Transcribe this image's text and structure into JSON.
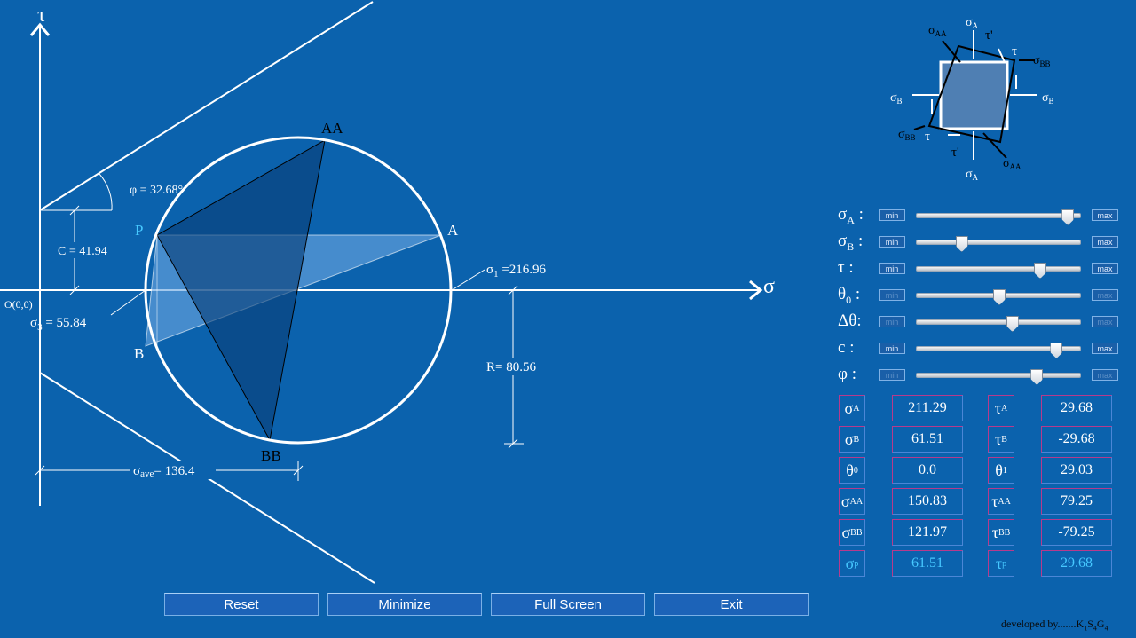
{
  "diagram": {
    "axis_tau_label": "τ",
    "axis_sigma_label": "σ",
    "origin_label": "O(0,0)",
    "point_labels": {
      "AA": "AA",
      "A": "A",
      "P": "P",
      "B": "B",
      "BB": "BB"
    },
    "phi_label": "φ = 32.68°",
    "c_label": "C = 41.94",
    "sigma1": {
      "main": "σ",
      "sub": "1",
      "rest": " =216.96"
    },
    "sigma3": {
      "main": "σ",
      "sub": "3",
      "rest": " = 55.84"
    },
    "radius_label": "R= 80.56",
    "sigma_ave": {
      "main": "σ",
      "sub": "ave",
      "rest": "= 136.4"
    }
  },
  "element": {
    "sigmaA": "σ",
    "sigmaA_sub": "A",
    "sigmaB": "σ",
    "sigmaB_sub": "B",
    "sigmaAA": "σ",
    "sigmaAA_sub": "AA",
    "sigmaBB": "σ",
    "sigmaBB_sub": "BB",
    "tau": "τ",
    "tau_prime": "τ'"
  },
  "sliders": [
    {
      "main": "σ",
      "sub": "A",
      "suffix": " :",
      "min_label": "min",
      "max_label": "max",
      "value": 0.92,
      "enabled": true
    },
    {
      "main": "σ",
      "sub": "B",
      "suffix": " :",
      "min_label": "min",
      "max_label": "max",
      "value": 0.27,
      "enabled": true
    },
    {
      "main": "τ",
      "sub": "",
      "suffix": " :",
      "min_label": "min",
      "max_label": "max",
      "value": 0.75,
      "enabled": true
    },
    {
      "main": "θ",
      "sub": "0",
      "suffix": " :",
      "min_label": "min",
      "max_label": "max",
      "value": 0.5,
      "enabled": false
    },
    {
      "main": "Δθ",
      "sub": "",
      "suffix": ":",
      "min_label": "min",
      "max_label": "max",
      "value": 0.58,
      "enabled": false
    },
    {
      "main": "c",
      "sub": "",
      "suffix": " :",
      "min_label": "min",
      "max_label": "max",
      "value": 0.85,
      "enabled": true
    },
    {
      "main": "φ",
      "sub": "",
      "suffix": " :",
      "min_label": "min",
      "max_label": "max",
      "value": 0.73,
      "enabled": false
    }
  ],
  "results": [
    {
      "k1": "σ",
      "s1": "A",
      "v1": "211.29",
      "k2": "τ",
      "s2": "A",
      "v2": "29.68",
      "highlight": false
    },
    {
      "k1": "σ",
      "s1": "B",
      "v1": "61.51",
      "k2": "τ",
      "s2": "B",
      "v2": "-29.68",
      "highlight": false
    },
    {
      "k1": "θ",
      "s1": "0",
      "v1": "0.0",
      "k2": "θ",
      "s2": "1",
      "v2": "29.03",
      "highlight": false
    },
    {
      "k1": "σ",
      "s1": "AA",
      "v1": "150.83",
      "k2": "τ",
      "s2": "AA",
      "v2": "79.25",
      "highlight": false
    },
    {
      "k1": "σ",
      "s1": "BB",
      "v1": "121.97",
      "k2": "τ",
      "s2": "BB",
      "v2": "-79.25",
      "highlight": false
    },
    {
      "k1": "σ",
      "s1": "p",
      "v1": "61.51",
      "k2": "τ",
      "s2": "p",
      "v2": "29.68",
      "highlight": true
    }
  ],
  "buttons": {
    "reset": "Reset",
    "minimize": "Minimize",
    "fullscreen": "Full Screen",
    "exit": "Exit"
  },
  "credit": {
    "prefix": "developed by.......K",
    "s1": "1",
    "m1": "S",
    "s2": "4",
    "m2": "G",
    "s3": "4"
  },
  "colors": {
    "background": "#0b62ad",
    "triangle_dark": "#0a3f78",
    "triangle_light": "#6aa6e0",
    "highlight": "#46c8ff"
  }
}
